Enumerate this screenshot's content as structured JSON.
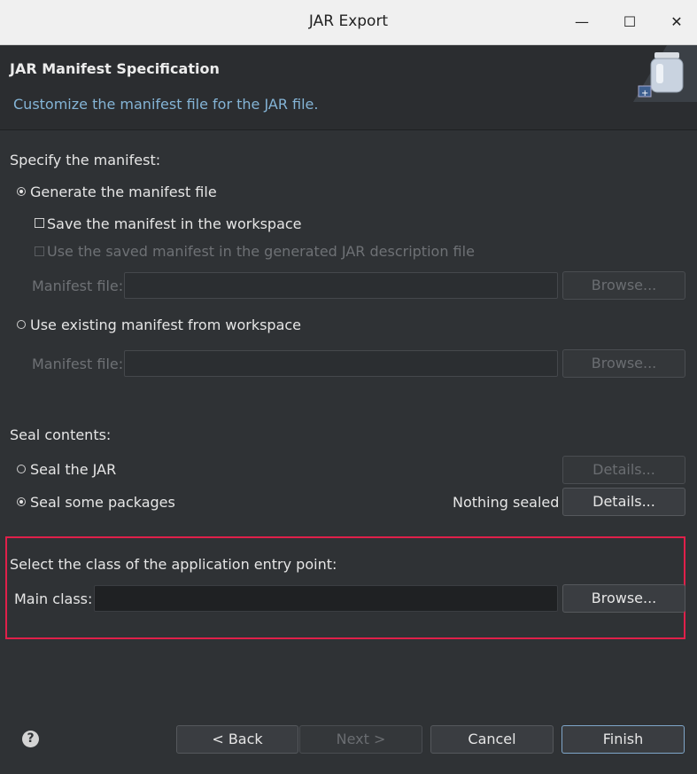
{
  "window": {
    "title": "JAR Export",
    "controls": {
      "minimize": "—",
      "maximize": "☐",
      "close": "✕"
    }
  },
  "header": {
    "title": "JAR Manifest Specification",
    "description": "Customize the manifest file for the JAR file."
  },
  "manifest": {
    "section_label": "Specify the manifest:",
    "generate_label": "Generate the manifest file",
    "save_label": "Save the manifest in the workspace",
    "use_saved_label": "Use the saved manifest in the generated JAR description file",
    "manifest_file_label_1": "Manifest file:",
    "browse_1": "Browse...",
    "use_existing_label": "Use existing manifest from workspace",
    "manifest_file_label_2": "Manifest file:",
    "browse_2": "Browse..."
  },
  "seal": {
    "section_label": "Seal contents:",
    "seal_jar_label": "Seal the JAR",
    "details_1": "Details...",
    "seal_some_label": "Seal some packages",
    "status": "Nothing sealed",
    "details_2": "Details..."
  },
  "entry": {
    "section_label": "Select the class of the application entry point:",
    "main_class_label": "Main class:",
    "main_class_value": "",
    "browse": "Browse..."
  },
  "footer": {
    "help": "?",
    "back": "< Back",
    "next": "Next >",
    "cancel": "Cancel",
    "finish": "Finish"
  },
  "colors": {
    "background": "#2f3235",
    "accent_link": "#84b4d6",
    "highlight_border": "#e0204a"
  }
}
